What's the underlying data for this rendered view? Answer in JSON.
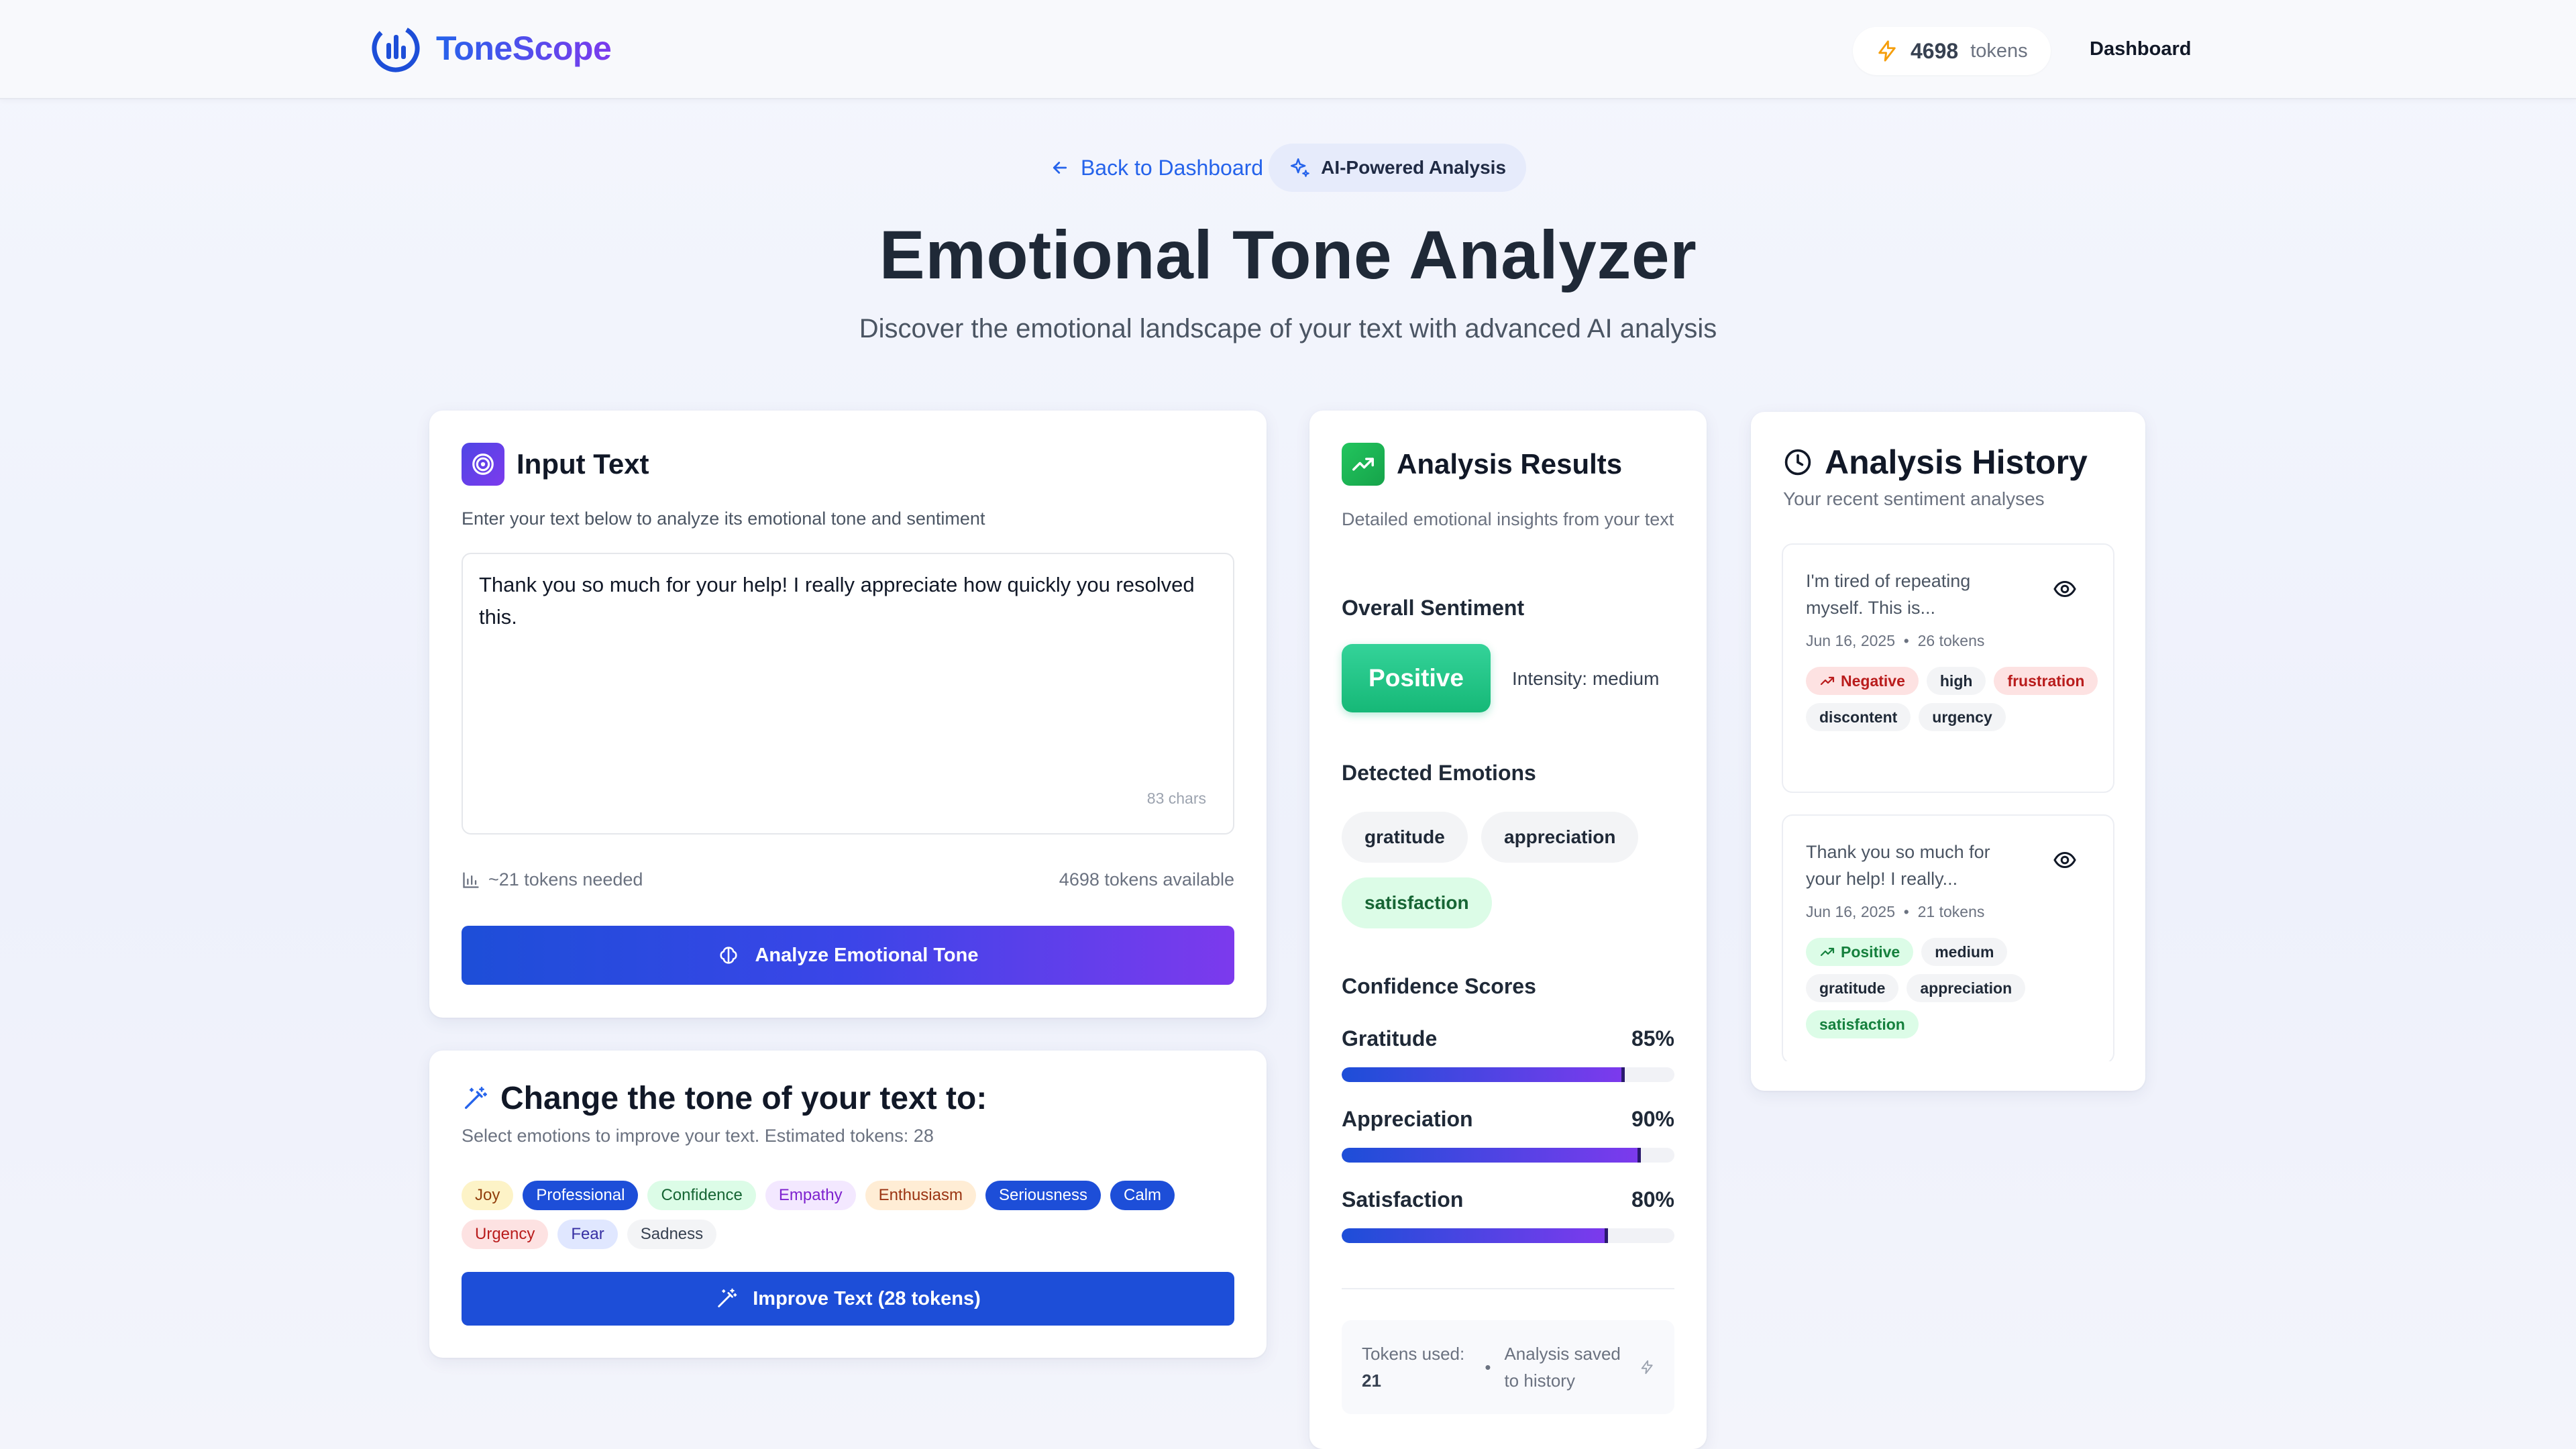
{
  "header": {
    "brand": "ToneScope",
    "tokens": "4698",
    "tokens_unit": "tokens",
    "nav_dashboard": "Dashboard"
  },
  "hero": {
    "back_link": "Back to Dashboard",
    "badge": "AI-Powered Analysis",
    "title": "Emotional Tone Analyzer",
    "subtitle": "Discover the emotional landscape of your text with advanced AI analysis"
  },
  "input_card": {
    "title": "Input Text",
    "description": "Enter your text below to analyze its emotional tone and sentiment",
    "text_value": "Thank you so much for your help! I really appreciate how quickly you resolved this.",
    "char_count": "83 chars",
    "tokens_needed": "~21 tokens needed",
    "tokens_available": "4698 tokens available",
    "analyze_button": "Analyze Emotional Tone"
  },
  "tone_card": {
    "title": "Change the tone of your text to:",
    "subtitle": "Select emotions to improve your text. Estimated tokens: 28",
    "chips": [
      {
        "label": "Joy",
        "bg": "#fdf3c7",
        "fg": "#92400e"
      },
      {
        "label": "Professional",
        "bg": "#1d4ed8",
        "fg": "#ffffff"
      },
      {
        "label": "Confidence",
        "bg": "#dcfce7",
        "fg": "#166534"
      },
      {
        "label": "Empathy",
        "bg": "#f3e8ff",
        "fg": "#7e22ce"
      },
      {
        "label": "Enthusiasm",
        "bg": "#ffedd5",
        "fg": "#9a3412"
      },
      {
        "label": "Seriousness",
        "bg": "#1d4ed8",
        "fg": "#ffffff"
      },
      {
        "label": "Calm",
        "bg": "#1d4ed8",
        "fg": "#ffffff"
      },
      {
        "label": "Urgency",
        "bg": "#fde2e2",
        "fg": "#b91c1c"
      },
      {
        "label": "Fear",
        "bg": "#e0e7ff",
        "fg": "#3730a3"
      },
      {
        "label": "Sadness",
        "bg": "#f3f4f6",
        "fg": "#374151"
      }
    ],
    "improve_button": "Improve Text (28 tokens)"
  },
  "results_card": {
    "title": "Analysis Results",
    "description": "Detailed emotional insights from your text",
    "overall_label": "Overall Sentiment",
    "sentiment": "Positive",
    "intensity": "Intensity: medium",
    "emotions_label": "Detected Emotions",
    "emotions": [
      {
        "label": "gratitude"
      },
      {
        "label": "appreciation"
      },
      {
        "label": "satisfaction"
      }
    ],
    "confidence_label": "Confidence Scores",
    "scores": [
      {
        "label": "Gratitude",
        "value_text": "85%",
        "fraction": 0.85
      },
      {
        "label": "Appreciation",
        "value_text": "90%",
        "fraction": 0.9
      },
      {
        "label": "Satisfaction",
        "value_text": "80%",
        "fraction": 0.8
      }
    ],
    "footer_tokens_label": "Tokens used:",
    "footer_tokens_value": "21",
    "footer_saved": "Analysis saved to history"
  },
  "history_card": {
    "title": "Analysis History",
    "subtitle": "Your recent sentiment analyses",
    "items": [
      {
        "text": "I'm tired of repeating myself. This is...",
        "date": "Jun 16, 2025",
        "tokens": "26 tokens",
        "sentiment": "Negative",
        "intensity": "high",
        "emotions": [
          "frustration",
          "discontent",
          "urgency"
        ]
      },
      {
        "text": "Thank you so much for your help! I really...",
        "date": "Jun 16, 2025",
        "tokens": "21 tokens",
        "sentiment": "Positive",
        "intensity": "medium",
        "emotions": [
          "gratitude",
          "appreciation",
          "satisfaction"
        ]
      }
    ]
  },
  "colors": {
    "primary": "#1d4ed8",
    "accent": "#7c3aed",
    "positive": "#10b981",
    "negative": "#dc2626"
  }
}
